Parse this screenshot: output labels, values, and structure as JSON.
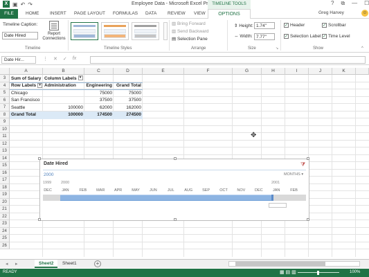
{
  "window": {
    "title": "Employee Data - Microsoft Excel Preview",
    "user": "Greg Harvey",
    "controls": [
      "?",
      "⧉",
      "—",
      "☐",
      "✕"
    ]
  },
  "qat": {
    "logo": "X",
    "icons": [
      "save-icon",
      "undo-icon",
      "redo-icon"
    ]
  },
  "ribbon": {
    "contextual_group": "TIMELINE TOOLS",
    "tabs": [
      "FILE",
      "HOME",
      "INSERT",
      "PAGE LAYOUT",
      "FORMULAS",
      "DATA",
      "REVIEW",
      "VIEW",
      "OPTIONS"
    ],
    "timeline_group": {
      "caption_label": "Timeline Caption:",
      "caption_value": "Date Hired",
      "report_connections": "Report Connections",
      "label": "Timeline"
    },
    "styles_group": {
      "label": "Timeline Styles"
    },
    "arrange_group": {
      "bring_forward": "Bring Forward",
      "send_backward": "Send Backward",
      "selection_pane": "Selection Pane",
      "label": "Arrange"
    },
    "size_group": {
      "height_label": "Height:",
      "height_value": "1.74\"",
      "width_label": "Width:",
      "width_value": "7.77\"",
      "label": "Size"
    },
    "show_group": {
      "header": "Header",
      "scrollbar": "Scrollbar",
      "selection_label": "Selection Label",
      "time_level": "Time Level",
      "label": "Show"
    }
  },
  "formula_bar": {
    "name_box": "Date Hir...",
    "icons": [
      "⋮",
      "✕",
      "✓",
      "fx"
    ],
    "content": ""
  },
  "grid": {
    "columns": [
      "A",
      "B",
      "C",
      "D",
      "E",
      "F",
      "G",
      "H",
      "I",
      "J",
      "K"
    ],
    "rows": [
      "3",
      "4",
      "5",
      "6",
      "7",
      "8",
      "9",
      "10",
      "11",
      "12",
      "13",
      "14",
      "15",
      "16",
      "17",
      "18",
      "19",
      "20",
      "21",
      "22",
      "23",
      "24",
      "25",
      "26"
    ],
    "pivot": {
      "r3": [
        "Sum of Salary",
        "Column Labels",
        "",
        ""
      ],
      "r4": [
        "Row Labels",
        "Administration",
        "Engineering",
        "Grand Total"
      ],
      "r5": [
        "Chicago",
        "",
        "75000",
        "75000"
      ],
      "r6": [
        "San Francisco",
        "",
        "37500",
        "37500"
      ],
      "r7": [
        "Seattle",
        "100000",
        "62000",
        "162000"
      ],
      "r8": [
        "Grand Total",
        "100000",
        "174500",
        "274500"
      ]
    }
  },
  "timeline": {
    "title": "Date Hired",
    "selected_year": "2000",
    "time_level": "MONTHS",
    "year_labels": {
      "left": "1999",
      "mid": "2000",
      "right": "2001"
    },
    "months": [
      "DEC",
      "JAN",
      "FEB",
      "MAR",
      "APR",
      "MAY",
      "JUN",
      "JUL",
      "AUG",
      "SEP",
      "OCT",
      "NOV",
      "DEC",
      "JAN",
      "FEB"
    ],
    "selection": {
      "first_month": "JAN",
      "last_month": "DEC",
      "year": "2000"
    }
  },
  "sheets": {
    "tabs": [
      "Sheet2",
      "Sheet1"
    ],
    "active": "Sheet2",
    "add": "+"
  },
  "status": {
    "text": "READY",
    "zoom": "100%"
  }
}
